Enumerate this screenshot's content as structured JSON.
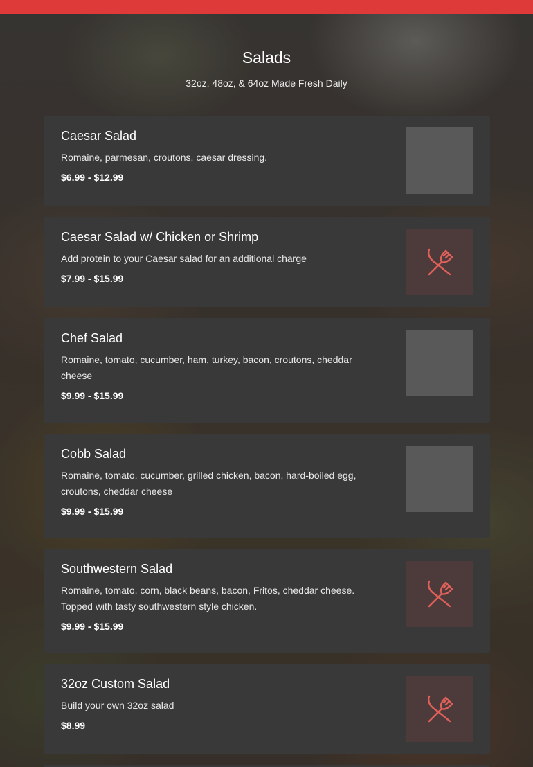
{
  "menu": {
    "section_title": "Salads",
    "section_subtitle": "32oz, 48oz, & 64oz Made Fresh Daily",
    "accent_color": "#df3a3a",
    "items": [
      {
        "name": "Caesar Salad",
        "description": "Romaine, parmesan, croutons, caesar dressing.",
        "price": "$6.99 - $12.99",
        "image": "photo"
      },
      {
        "name": "Caesar Salad w/ Chicken or Shrimp",
        "description": "Add protein to your Caesar salad for an additional charge",
        "price": "$7.99 - $15.99",
        "image": "utensils-icon"
      },
      {
        "name": "Chef Salad",
        "description": "Romaine, tomato, cucumber, ham, turkey, bacon, croutons, cheddar cheese",
        "price": "$9.99 - $15.99",
        "image": "photo"
      },
      {
        "name": "Cobb Salad",
        "description": "Romaine, tomato, cucumber, grilled chicken, bacon, hard-boiled egg, croutons, cheddar cheese",
        "price": "$9.99 - $15.99",
        "image": "photo"
      },
      {
        "name": "Southwestern Salad",
        "description": "Romaine, tomato, corn, black beans, bacon, Fritos, cheddar cheese. Topped with tasty southwestern style chicken.",
        "price": "$9.99 - $15.99",
        "image": "utensils-icon"
      },
      {
        "name": "32oz Custom Salad",
        "description": "Build your own 32oz salad",
        "price": "$8.99",
        "image": "utensils-icon"
      }
    ]
  }
}
